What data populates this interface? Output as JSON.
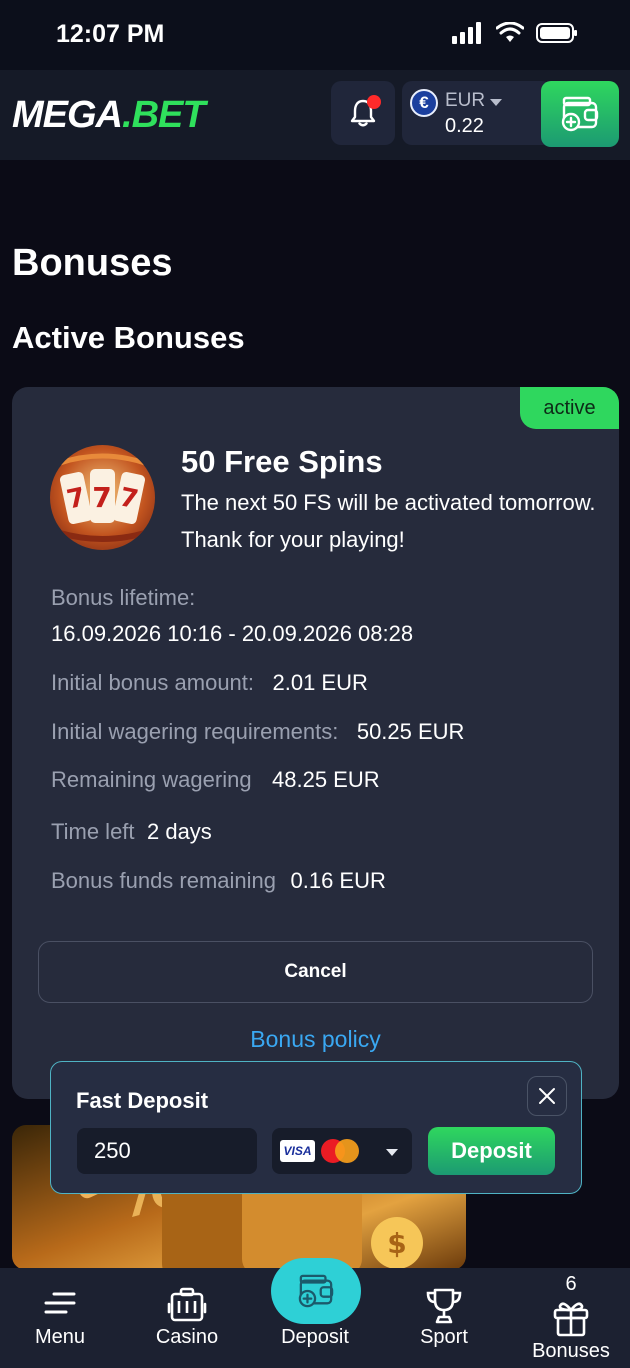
{
  "status_bar": {
    "time": "12:07 PM"
  },
  "header": {
    "logo_part1": "MEGA",
    "logo_dot": ".",
    "logo_part2": "BET",
    "currency": "EUR",
    "currency_symbol": "€",
    "balance": "0.22"
  },
  "page": {
    "title": "Bonuses",
    "section_title": "Active Bonuses"
  },
  "bonus": {
    "status": "active",
    "name": "50 Free Spins",
    "description": "The next 50 FS will be activated tomorrow. Thank for your playing!",
    "lifetime_label": "Bonus lifetime:",
    "lifetime_value": "16.09.2026 10:16 - 20.09.2026 08:28",
    "initial_amount_label": "Initial bonus amount:",
    "initial_amount_value": "2.01 EUR",
    "wagering_req_label": "Initial wagering requirements:",
    "wagering_req_value": "50.25 EUR",
    "remaining_wagering_label": "Remaining wagering",
    "remaining_wagering_value": "48.25 EUR",
    "time_left_label": "Time left",
    "time_left_value": "2 days",
    "funds_remaining_label": "Bonus funds remaining",
    "funds_remaining_value": "0.16 EUR",
    "cancel_label": "Cancel",
    "policy_link": "Bonus policy",
    "slot_symbol": "777"
  },
  "fast_deposit": {
    "title": "Fast Deposit",
    "amount": "250",
    "card_brand": "VISA",
    "deposit_label": "Deposit"
  },
  "promo": {
    "glyph": "%"
  },
  "bottom_nav": {
    "menu": "Menu",
    "casino": "Casino",
    "deposit": "Deposit",
    "sport": "Sport",
    "bonuses": "Bonuses",
    "bonuses_count": "6"
  },
  "colors": {
    "accent_green": "#2fd75e",
    "link_blue": "#3aa8f2",
    "card_bg": "#262b3c",
    "deposit_teal": "#2ed0d6"
  }
}
